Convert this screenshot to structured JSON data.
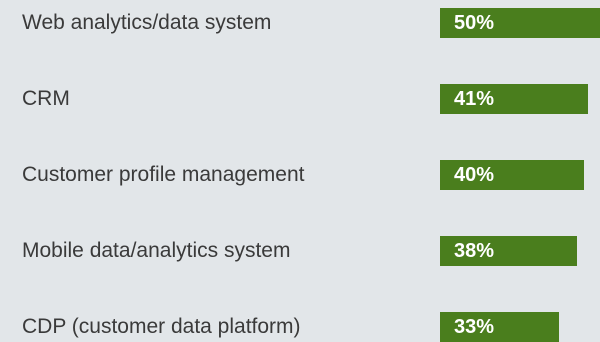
{
  "chart_data": {
    "type": "bar",
    "orientation": "horizontal",
    "categories": [
      "Web analytics/data system",
      "CRM",
      "Customer profile management",
      "Mobile data/analytics system",
      "CDP (customer data platform)"
    ],
    "values": [
      50,
      41,
      40,
      38,
      33
    ],
    "value_labels": [
      "50%",
      "41%",
      "40%",
      "38%",
      "33%"
    ],
    "unit": "%",
    "title": "",
    "xlabel": "",
    "ylabel": "",
    "grid": false,
    "colors": {
      "bar": "#4a7e1d",
      "background": "#e2e6e9",
      "label_text": "#3a3a3a",
      "value_text": "#ffffff"
    }
  }
}
